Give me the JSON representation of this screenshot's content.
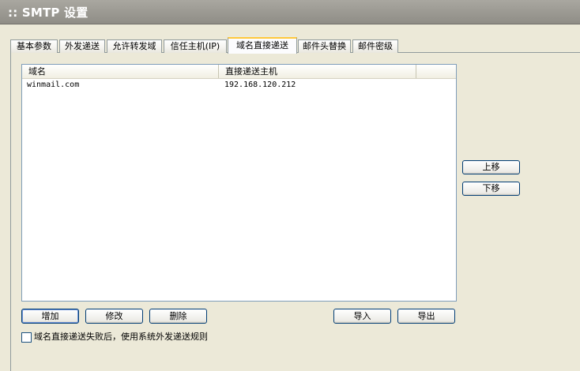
{
  "window": {
    "title": ":: SMTP 设置"
  },
  "tabs": [
    {
      "label": "基本参数"
    },
    {
      "label": "外发递送"
    },
    {
      "label": "允许转发域"
    },
    {
      "label": "信任主机(IP)"
    },
    {
      "label": "域名直接递送",
      "active": true
    },
    {
      "label": "邮件头替换"
    },
    {
      "label": "邮件密级"
    }
  ],
  "list": {
    "columns": [
      "域名",
      "直接递送主机"
    ],
    "rows": [
      {
        "domain": "winmail.com",
        "host": "192.168.120.212"
      }
    ]
  },
  "buttons": {
    "up": "上移",
    "down": "下移",
    "add": "增加",
    "edit": "修改",
    "delete": "删除",
    "import": "导入",
    "export": "导出"
  },
  "option": {
    "label": "域名直接递送失败后，使用系统外发递送规则",
    "checked": false
  }
}
